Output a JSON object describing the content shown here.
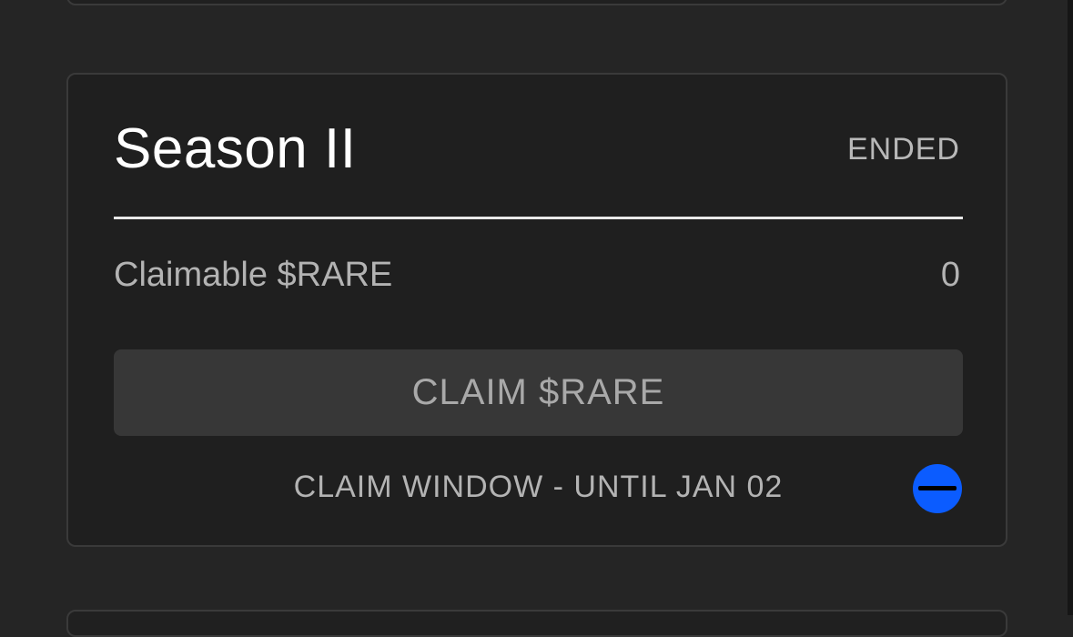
{
  "season": {
    "title": "Season II",
    "status": "ENDED",
    "claimable_label": "Claimable $RARE",
    "claimable_value": "0",
    "claim_button_label": "CLAIM $RARE",
    "claim_window_text": "CLAIM WINDOW - UNTIL JAN 02",
    "toggle_icon": "minus-circle-icon"
  },
  "colors": {
    "background": "#252525",
    "card_background": "#1f1f1f",
    "card_border": "#3a3a3a",
    "button_background": "#373737",
    "accent_blue": "#0b5cff",
    "title_text": "#ffffff",
    "muted_text": "#b3b3b3"
  }
}
